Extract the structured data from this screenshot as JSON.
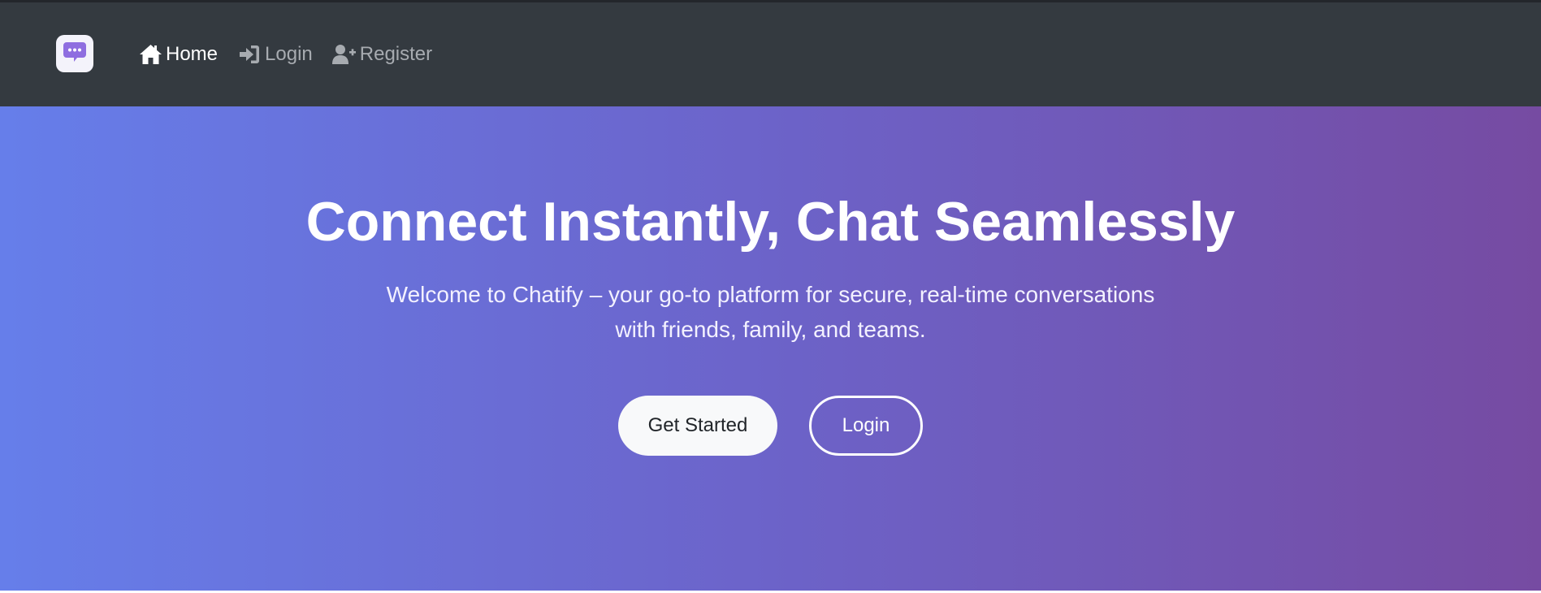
{
  "colors": {
    "navbar_bg": "#343a40",
    "hero_gradient_start": "#667eea",
    "hero_gradient_end": "#764ba2",
    "brand_icon": "#8f6ee0",
    "nav_active": "#ffffff",
    "nav_inactive": "#a7abb0"
  },
  "navbar": {
    "logo_icon": "chat-bubble-icon",
    "links": [
      {
        "label": "Home",
        "icon": "home-icon",
        "active": true
      },
      {
        "label": "Login",
        "icon": "sign-in-icon",
        "active": false
      },
      {
        "label": "Register",
        "icon": "user-plus-icon",
        "active": false
      }
    ]
  },
  "hero": {
    "title": "Connect Instantly, Chat Seamlessly",
    "subtitle": "Welcome to Chatify – your go-to platform for secure, real-time conversations with friends, family, and teams.",
    "primary_button": "Get Started",
    "secondary_button": "Login"
  }
}
